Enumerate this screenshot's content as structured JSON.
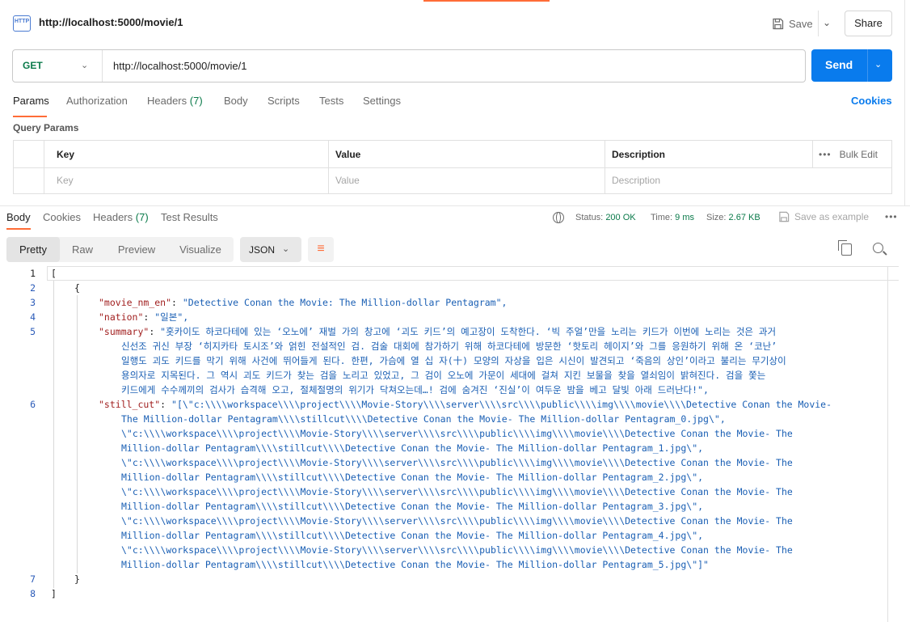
{
  "titlebar": {
    "icon_text": "HTTP",
    "title": "http://localhost:5000/movie/1",
    "save_label": "Save",
    "share_label": "Share"
  },
  "request": {
    "method": "GET",
    "url": "http://localhost:5000/movie/1",
    "send_label": "Send"
  },
  "req_tabs": [
    {
      "label": "Params"
    },
    {
      "label": "Authorization"
    },
    {
      "label": "Headers",
      "count": "(7)"
    },
    {
      "label": "Body"
    },
    {
      "label": "Scripts"
    },
    {
      "label": "Tests"
    },
    {
      "label": "Settings"
    }
  ],
  "cookies_label": "Cookies",
  "query_params": {
    "label": "Query Params",
    "headers": {
      "key": "Key",
      "value": "Value",
      "description": "Description",
      "bulk_edit": "Bulk Edit"
    },
    "placeholders": {
      "key": "Key",
      "value": "Value",
      "description": "Description"
    }
  },
  "resp_tabs": [
    {
      "label": "Body"
    },
    {
      "label": "Cookies"
    },
    {
      "label": "Headers",
      "count": "(7)"
    },
    {
      "label": "Test Results"
    }
  ],
  "status": {
    "status_label": "Status:",
    "status_value": "200 OK",
    "time_label": "Time:",
    "time_value": "9 ms",
    "size_label": "Size:",
    "size_value": "2.67 KB",
    "save_example": "Save as example"
  },
  "view_tabs": [
    {
      "label": "Pretty"
    },
    {
      "label": "Raw"
    },
    {
      "label": "Preview"
    },
    {
      "label": "Visualize"
    }
  ],
  "format": "JSON",
  "colors": {
    "accent": "#ff6c37",
    "primary": "#097bed",
    "method": "#0a7a4a",
    "json_key": "#a11f1f",
    "json_string": "#1a5fb4"
  },
  "code": {
    "line_numbers": [
      "1",
      "2",
      "3",
      "4",
      "5",
      "6",
      "7",
      "8"
    ],
    "lines": [
      {
        "text": "["
      },
      {
        "text": "{"
      },
      {
        "key": "\"movie_nm_en\"",
        "val": "\"Detective Conan the Movie: The Million-dollar Pentagram\","
      },
      {
        "key": "\"nation\"",
        "val": "\"일본\","
      },
      {
        "key": "\"summary\"",
        "val": "\"홋카이도 하코다테에 있는 ‘오노에’ 재벌 가의 창고에 ‘괴도 키드’의 예고장이 도착한다. ‘빅 주얼’만을 노리는 키드가 이번에 노리는 것은 과거"
      },
      {
        "text": "신선조 귀신 부장 ‘히지카타 토시조’와 얽힌 전설적인 검. 검술 대회에 참가하기 위해 하코다테에 방문한 ‘핫토리 헤이지’와 그를 응원하기 위해 온 ‘코난’"
      },
      {
        "text": "일행도 괴도 키드를 막기 위해 사건에 뛰어들게 된다. 한편, 가슴에 열 십 자(十) 모양의 자상을 입은 시신이 발견되고 ‘죽음의 상인’이라고 불리는 무기상이"
      },
      {
        "text": "용의자로 지목된다. 그 역시 괴도 키드가 찾는 검을 노리고 있었고, 그 검이 오노에 가문이 세대에 걸쳐 지킨 보물을 찾을 열쇠임이 밝혀진다. 검을 쫓는"
      },
      {
        "text": "키드에게 수수께끼의 검사가 습격해 오고, 절체절명의 위기가 닥쳐오는데…! 검에 숨겨진 ‘진실’이 여두운 밤을 베고 달빛 아래 드러난다!\","
      },
      {
        "key": "\"still_cut\"",
        "val": "\"[\\\"c:\\\\\\\\workspace\\\\\\\\project\\\\\\\\Movie-Story\\\\\\\\server\\\\\\\\src\\\\\\\\public\\\\\\\\img\\\\\\\\movie\\\\\\\\Detective Conan the Movie-"
      },
      {
        "text": "The Million-dollar Pentagram\\\\\\\\stillcut\\\\\\\\Detective Conan the Movie- The Million-dollar Pentagram_0.jpg\\\","
      },
      {
        "text": "\\\"c:\\\\\\\\workspace\\\\\\\\project\\\\\\\\Movie-Story\\\\\\\\server\\\\\\\\src\\\\\\\\public\\\\\\\\img\\\\\\\\movie\\\\\\\\Detective Conan the Movie- The"
      },
      {
        "text": "Million-dollar Pentagram\\\\\\\\stillcut\\\\\\\\Detective Conan the Movie- The Million-dollar Pentagram_1.jpg\\\","
      },
      {
        "text": "\\\"c:\\\\\\\\workspace\\\\\\\\project\\\\\\\\Movie-Story\\\\\\\\server\\\\\\\\src\\\\\\\\public\\\\\\\\img\\\\\\\\movie\\\\\\\\Detective Conan the Movie- The"
      },
      {
        "text": "Million-dollar Pentagram\\\\\\\\stillcut\\\\\\\\Detective Conan the Movie- The Million-dollar Pentagram_2.jpg\\\","
      },
      {
        "text": "\\\"c:\\\\\\\\workspace\\\\\\\\project\\\\\\\\Movie-Story\\\\\\\\server\\\\\\\\src\\\\\\\\public\\\\\\\\img\\\\\\\\movie\\\\\\\\Detective Conan the Movie- The"
      },
      {
        "text": "Million-dollar Pentagram\\\\\\\\stillcut\\\\\\\\Detective Conan the Movie- The Million-dollar Pentagram_3.jpg\\\","
      },
      {
        "text": "\\\"c:\\\\\\\\workspace\\\\\\\\project\\\\\\\\Movie-Story\\\\\\\\server\\\\\\\\src\\\\\\\\public\\\\\\\\img\\\\\\\\movie\\\\\\\\Detective Conan the Movie- The"
      },
      {
        "text": "Million-dollar Pentagram\\\\\\\\stillcut\\\\\\\\Detective Conan the Movie- The Million-dollar Pentagram_4.jpg\\\","
      },
      {
        "text": "\\\"c:\\\\\\\\workspace\\\\\\\\project\\\\\\\\Movie-Story\\\\\\\\server\\\\\\\\src\\\\\\\\public\\\\\\\\img\\\\\\\\movie\\\\\\\\Detective Conan the Movie- The"
      },
      {
        "text": "Million-dollar Pentagram\\\\\\\\stillcut\\\\\\\\Detective Conan the Movie- The Million-dollar Pentagram_5.jpg\\\"]\""
      },
      {
        "text": "}"
      },
      {
        "text": "]"
      }
    ]
  }
}
